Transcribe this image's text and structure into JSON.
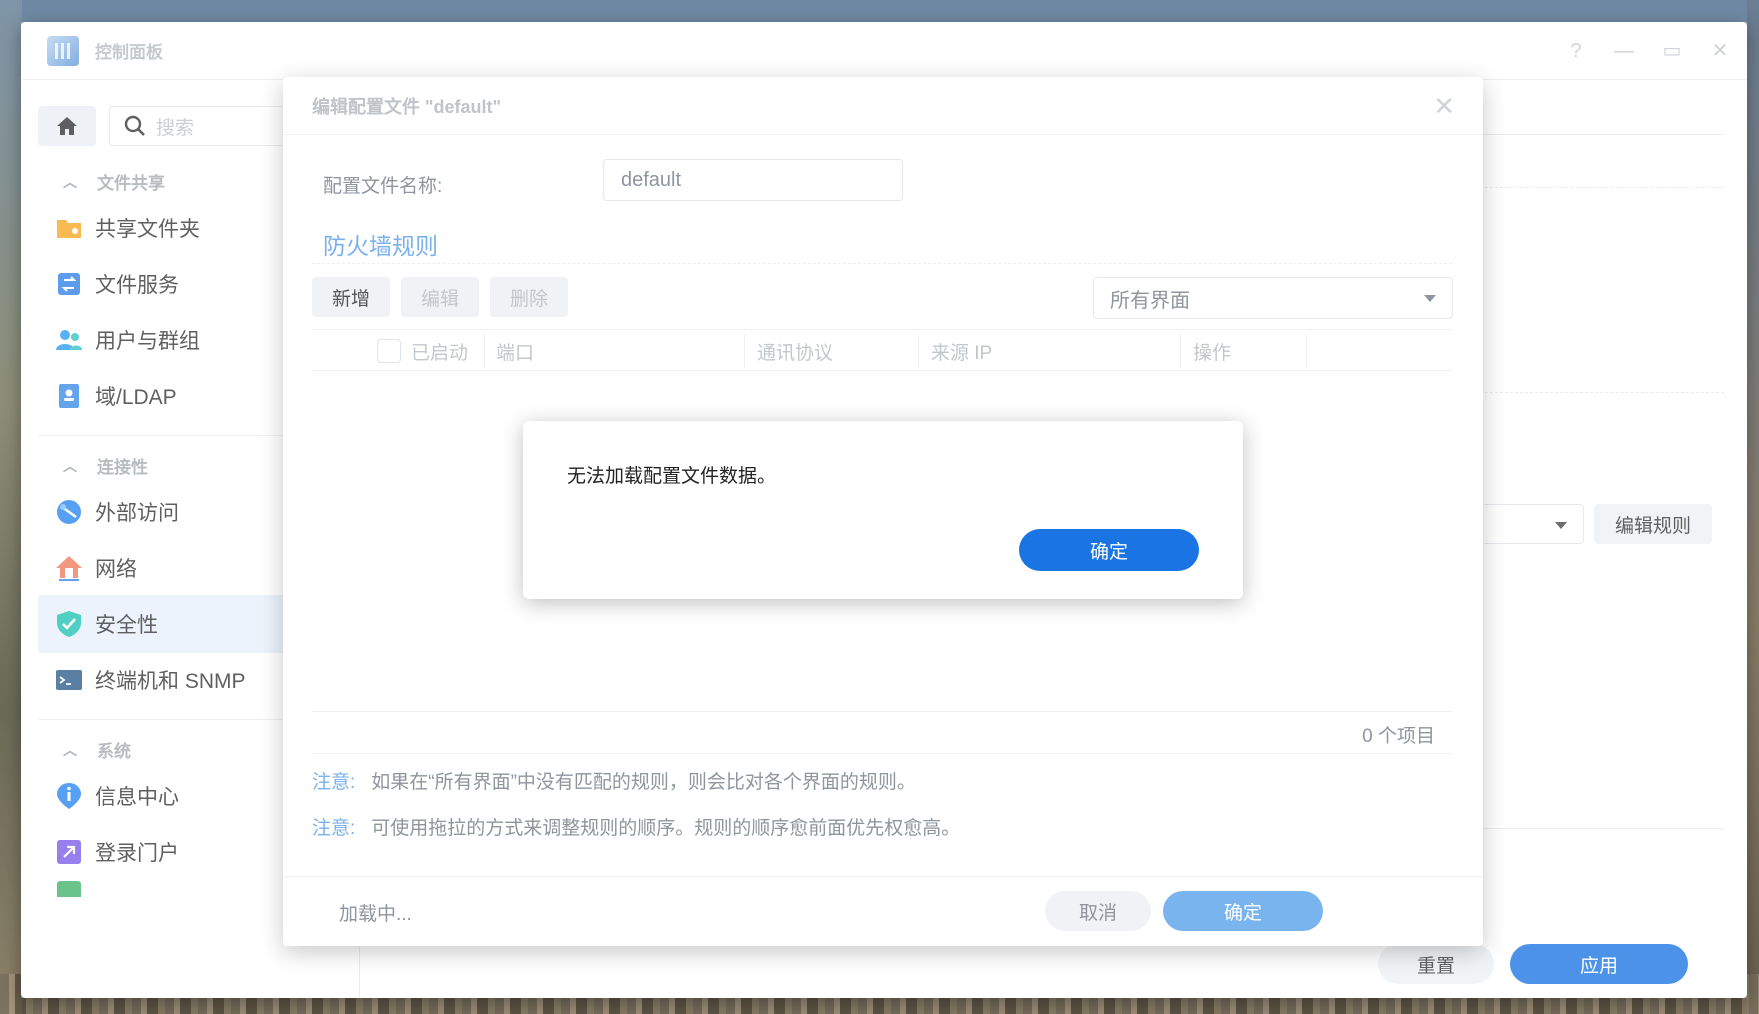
{
  "window": {
    "title": "控制面板",
    "controls": {
      "help": "?",
      "minimize": "—",
      "maximize": "▭",
      "close": "✕"
    }
  },
  "sidebar": {
    "search_placeholder": "搜索",
    "sections": [
      {
        "title": "文件共享",
        "items": [
          {
            "label": "共享文件夹",
            "icon": "folder-share-icon"
          },
          {
            "label": "文件服务",
            "icon": "file-services-icon"
          },
          {
            "label": "用户与群组",
            "icon": "users-groups-icon"
          },
          {
            "label": "域/LDAP",
            "icon": "domain-ldap-icon"
          }
        ]
      },
      {
        "title": "连接性",
        "items": [
          {
            "label": "外部访问",
            "icon": "external-access-icon"
          },
          {
            "label": "网络",
            "icon": "network-icon"
          },
          {
            "label": "安全性",
            "icon": "shield-check-icon",
            "active": true
          },
          {
            "label": "终端机和 SNMP",
            "icon": "terminal-icon"
          }
        ]
      },
      {
        "title": "系统",
        "items": [
          {
            "label": "信息中心",
            "icon": "info-center-icon"
          },
          {
            "label": "登录门户",
            "icon": "login-portal-icon"
          }
        ]
      }
    ]
  },
  "background": {
    "edit_rules_button": "编辑规则",
    "reset_button": "重置",
    "apply_button": "应用"
  },
  "dialog": {
    "title": "编辑配置文件 \"default\"",
    "profile_name_label": "配置文件名称:",
    "profile_name_value": "default",
    "section_title": "防火墙规则",
    "toolbar": {
      "add": "新增",
      "edit": "编辑",
      "delete": "删除"
    },
    "interface_select": "所有界面",
    "table_headers": {
      "enabled": "已启动",
      "port": "端口",
      "protocol": "通讯协议",
      "source_ip": "来源 IP",
      "action": "操作"
    },
    "item_count": "0 个项目",
    "notes": [
      {
        "tag": "注意:",
        "text": "如果在“所有界面”中没有匹配的规则，则会比对各个界面的规则。"
      },
      {
        "tag": "注意:",
        "text": "可使用拖拉的方式来调整规则的顺序。规则的顺序愈前面优先权愈高。"
      }
    ],
    "loading_text": "加载中...",
    "cancel_button": "取消",
    "ok_button": "确定"
  },
  "alert": {
    "message": "无法加载配置文件数据。",
    "ok_button": "确定"
  },
  "colors": {
    "accent": "#1a74e3",
    "accent_light": "#7ab1ea",
    "active_bg": "#e7f0fb"
  }
}
